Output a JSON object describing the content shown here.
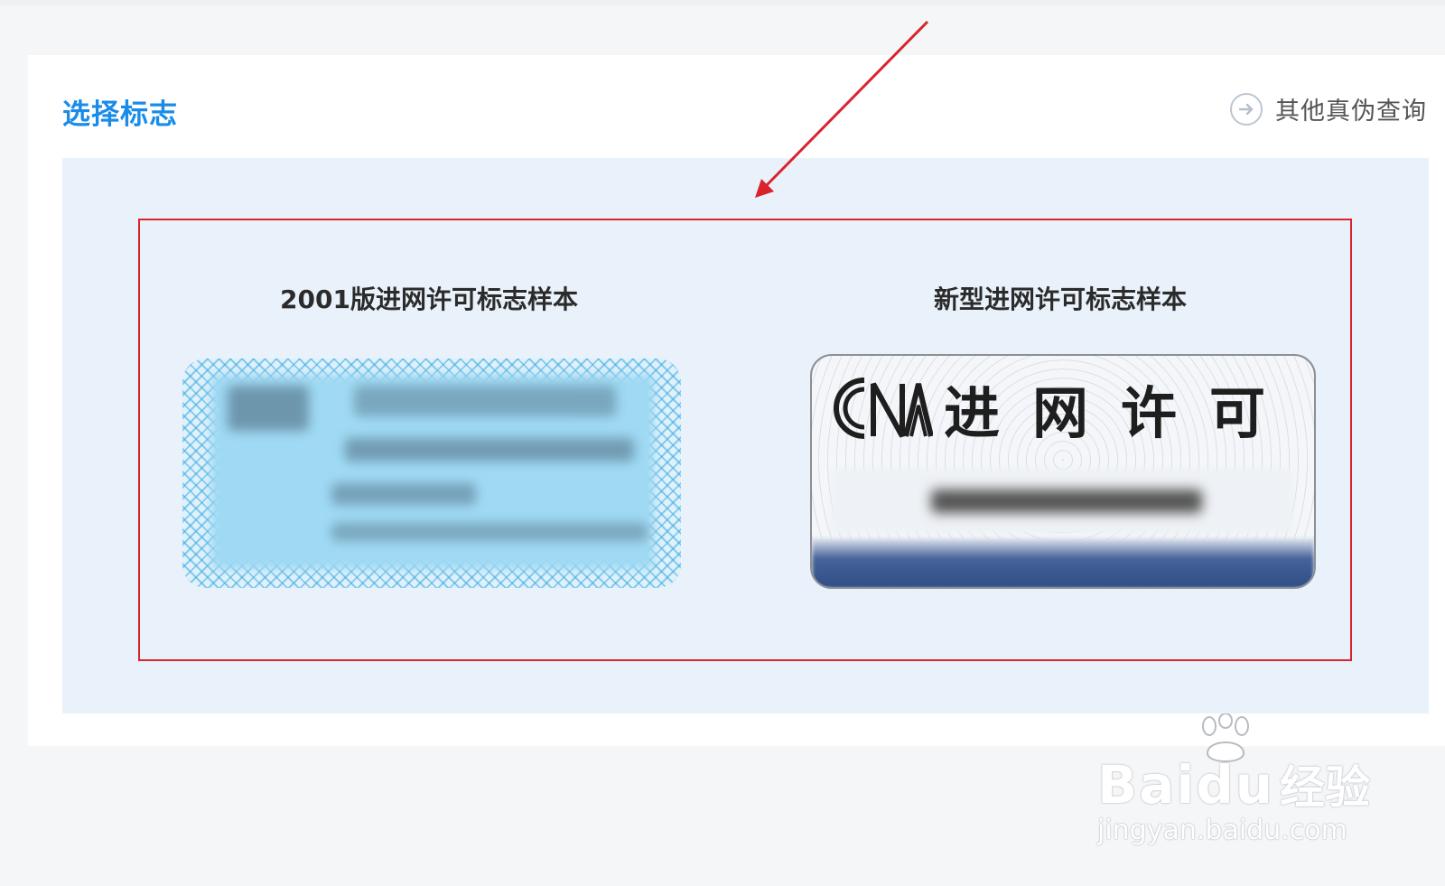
{
  "card": {
    "title": "选择标志",
    "other_link_label": "其他真伪查询",
    "other_link_icon": "arrow-right-circle-icon"
  },
  "samples": [
    {
      "title": "2001版进网许可标志样本",
      "image": "blurred-2001-network-access-label"
    },
    {
      "title": "新型进网许可标志样本",
      "image": "blurred-new-network-access-label",
      "logo_text": "CNTA",
      "label_text": "进网许可"
    }
  ],
  "annotation": {
    "color": "#d9242d"
  },
  "watermark": {
    "brand": "Baidu",
    "brand_cn": "经验",
    "url": "jingyan.baidu.com"
  },
  "colors": {
    "title_blue": "#1a8ce8",
    "panel_bg": "#e9f1fa",
    "annotation_red": "#d9242d"
  }
}
